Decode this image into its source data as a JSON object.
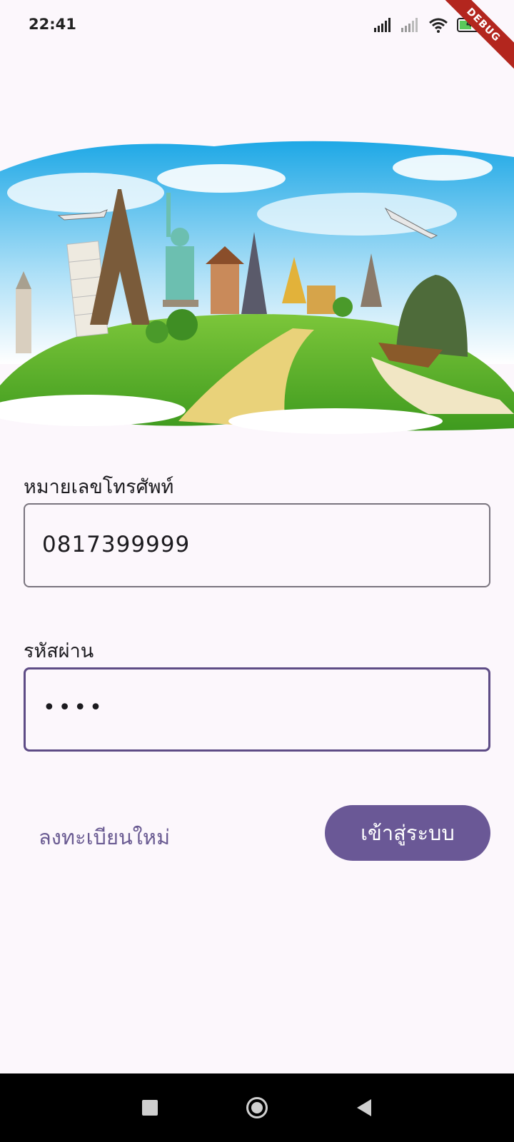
{
  "status_bar": {
    "time": "22:41",
    "battery_level": "43",
    "icons": [
      "signal-icon",
      "signal-icon",
      "wifi-icon",
      "battery-icon"
    ],
    "debug_banner": "DEBUG"
  },
  "hero": {
    "image_alt_icon": "travel-landmarks-illustration"
  },
  "form": {
    "phone_label": "หมายเลขโทรศัพท์",
    "phone_value": "0817399999",
    "password_label": "รหัสผ่าน",
    "password_value": "••••"
  },
  "actions": {
    "register_label": "ลงทะเบียนใหม่",
    "login_label": "เข้าสู่ระบบ"
  },
  "colors": {
    "background": "#fcf7fc",
    "primary": "#6a5896",
    "focused_border": "#5e4c86",
    "outline": "#79747e"
  },
  "nav_bar": {
    "buttons": [
      "recents-icon",
      "home-icon",
      "back-icon"
    ]
  }
}
